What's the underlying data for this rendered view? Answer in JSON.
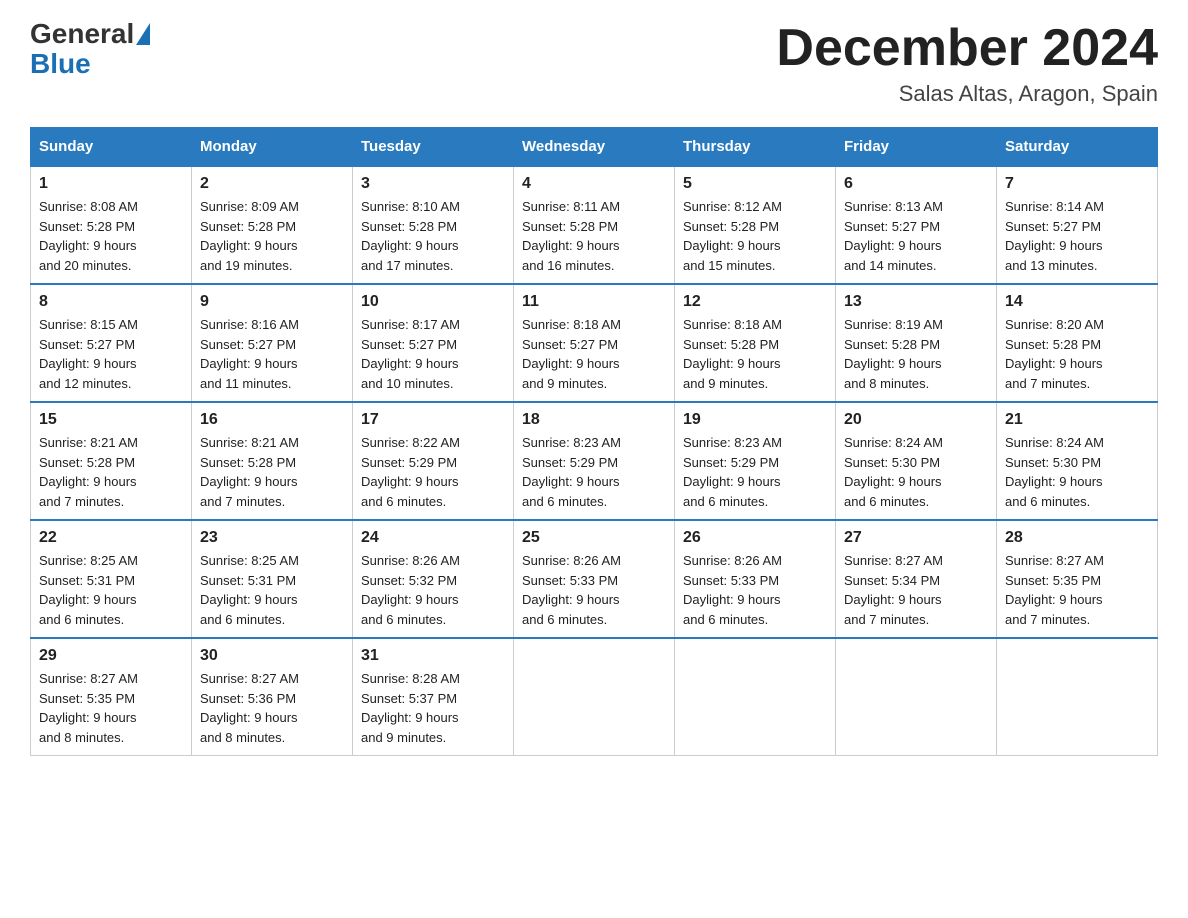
{
  "header": {
    "logo_general": "General",
    "logo_blue": "Blue",
    "month_title": "December 2024",
    "location": "Salas Altas, Aragon, Spain"
  },
  "days_of_week": [
    "Sunday",
    "Monday",
    "Tuesday",
    "Wednesday",
    "Thursday",
    "Friday",
    "Saturday"
  ],
  "weeks": [
    [
      {
        "day": "1",
        "sunrise": "8:08 AM",
        "sunset": "5:28 PM",
        "daylight": "9 hours and 20 minutes."
      },
      {
        "day": "2",
        "sunrise": "8:09 AM",
        "sunset": "5:28 PM",
        "daylight": "9 hours and 19 minutes."
      },
      {
        "day": "3",
        "sunrise": "8:10 AM",
        "sunset": "5:28 PM",
        "daylight": "9 hours and 17 minutes."
      },
      {
        "day": "4",
        "sunrise": "8:11 AM",
        "sunset": "5:28 PM",
        "daylight": "9 hours and 16 minutes."
      },
      {
        "day": "5",
        "sunrise": "8:12 AM",
        "sunset": "5:28 PM",
        "daylight": "9 hours and 15 minutes."
      },
      {
        "day": "6",
        "sunrise": "8:13 AM",
        "sunset": "5:27 PM",
        "daylight": "9 hours and 14 minutes."
      },
      {
        "day": "7",
        "sunrise": "8:14 AM",
        "sunset": "5:27 PM",
        "daylight": "9 hours and 13 minutes."
      }
    ],
    [
      {
        "day": "8",
        "sunrise": "8:15 AM",
        "sunset": "5:27 PM",
        "daylight": "9 hours and 12 minutes."
      },
      {
        "day": "9",
        "sunrise": "8:16 AM",
        "sunset": "5:27 PM",
        "daylight": "9 hours and 11 minutes."
      },
      {
        "day": "10",
        "sunrise": "8:17 AM",
        "sunset": "5:27 PM",
        "daylight": "9 hours and 10 minutes."
      },
      {
        "day": "11",
        "sunrise": "8:18 AM",
        "sunset": "5:27 PM",
        "daylight": "9 hours and 9 minutes."
      },
      {
        "day": "12",
        "sunrise": "8:18 AM",
        "sunset": "5:28 PM",
        "daylight": "9 hours and 9 minutes."
      },
      {
        "day": "13",
        "sunrise": "8:19 AM",
        "sunset": "5:28 PM",
        "daylight": "9 hours and 8 minutes."
      },
      {
        "day": "14",
        "sunrise": "8:20 AM",
        "sunset": "5:28 PM",
        "daylight": "9 hours and 7 minutes."
      }
    ],
    [
      {
        "day": "15",
        "sunrise": "8:21 AM",
        "sunset": "5:28 PM",
        "daylight": "9 hours and 7 minutes."
      },
      {
        "day": "16",
        "sunrise": "8:21 AM",
        "sunset": "5:28 PM",
        "daylight": "9 hours and 7 minutes."
      },
      {
        "day": "17",
        "sunrise": "8:22 AM",
        "sunset": "5:29 PM",
        "daylight": "9 hours and 6 minutes."
      },
      {
        "day": "18",
        "sunrise": "8:23 AM",
        "sunset": "5:29 PM",
        "daylight": "9 hours and 6 minutes."
      },
      {
        "day": "19",
        "sunrise": "8:23 AM",
        "sunset": "5:29 PM",
        "daylight": "9 hours and 6 minutes."
      },
      {
        "day": "20",
        "sunrise": "8:24 AM",
        "sunset": "5:30 PM",
        "daylight": "9 hours and 6 minutes."
      },
      {
        "day": "21",
        "sunrise": "8:24 AM",
        "sunset": "5:30 PM",
        "daylight": "9 hours and 6 minutes."
      }
    ],
    [
      {
        "day": "22",
        "sunrise": "8:25 AM",
        "sunset": "5:31 PM",
        "daylight": "9 hours and 6 minutes."
      },
      {
        "day": "23",
        "sunrise": "8:25 AM",
        "sunset": "5:31 PM",
        "daylight": "9 hours and 6 minutes."
      },
      {
        "day": "24",
        "sunrise": "8:26 AM",
        "sunset": "5:32 PM",
        "daylight": "9 hours and 6 minutes."
      },
      {
        "day": "25",
        "sunrise": "8:26 AM",
        "sunset": "5:33 PM",
        "daylight": "9 hours and 6 minutes."
      },
      {
        "day": "26",
        "sunrise": "8:26 AM",
        "sunset": "5:33 PM",
        "daylight": "9 hours and 6 minutes."
      },
      {
        "day": "27",
        "sunrise": "8:27 AM",
        "sunset": "5:34 PM",
        "daylight": "9 hours and 7 minutes."
      },
      {
        "day": "28",
        "sunrise": "8:27 AM",
        "sunset": "5:35 PM",
        "daylight": "9 hours and 7 minutes."
      }
    ],
    [
      {
        "day": "29",
        "sunrise": "8:27 AM",
        "sunset": "5:35 PM",
        "daylight": "9 hours and 8 minutes."
      },
      {
        "day": "30",
        "sunrise": "8:27 AM",
        "sunset": "5:36 PM",
        "daylight": "9 hours and 8 minutes."
      },
      {
        "day": "31",
        "sunrise": "8:28 AM",
        "sunset": "5:37 PM",
        "daylight": "9 hours and 9 minutes."
      },
      null,
      null,
      null,
      null
    ]
  ],
  "labels": {
    "sunrise": "Sunrise:",
    "sunset": "Sunset:",
    "daylight": "Daylight:"
  }
}
